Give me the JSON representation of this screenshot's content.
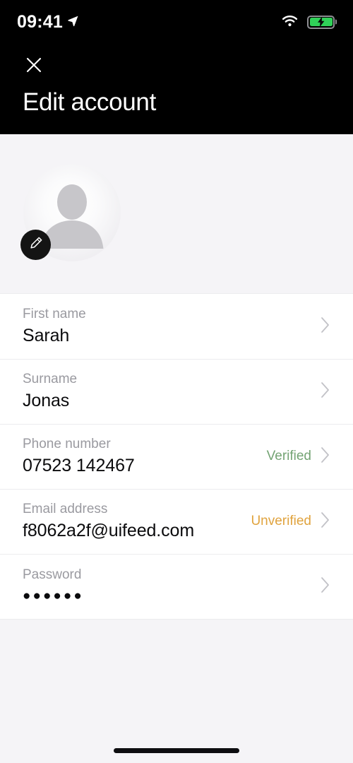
{
  "status_bar": {
    "time": "09:41",
    "location_icon": "location-arrow-icon",
    "wifi_icon": "wifi-icon",
    "battery_icon": "battery-charging-icon",
    "battery_color": "#30d158"
  },
  "header": {
    "close_icon": "close-icon",
    "title": "Edit account",
    "background": "#000000"
  },
  "avatar": {
    "placeholder_icon": "person-silhouette-icon",
    "edit_icon": "pencil-icon",
    "edit_button_label": "Edit profile photo"
  },
  "form": {
    "rows": [
      {
        "name": "first-name",
        "label": "First name",
        "value": "Sarah",
        "status": "",
        "status_kind": "",
        "chevron": "chevron-right-icon"
      },
      {
        "name": "surname",
        "label": "Surname",
        "value": "Jonas",
        "status": "",
        "status_kind": "",
        "chevron": "chevron-right-icon"
      },
      {
        "name": "phone-number",
        "label": "Phone number",
        "value": "07523 142467",
        "status": "Verified",
        "status_kind": "verified",
        "chevron": "chevron-right-icon"
      },
      {
        "name": "email-address",
        "label": "Email address",
        "value": "f8062a2f@uifeed.com",
        "status": "Unverified",
        "status_kind": "unverified",
        "chevron": "chevron-right-icon"
      },
      {
        "name": "password",
        "label": "Password",
        "value": "●●●●●●",
        "status": "",
        "status_kind": "",
        "chevron": "chevron-right-icon"
      }
    ]
  },
  "colors": {
    "page_background": "#f5f4f7",
    "card_background": "#ffffff",
    "divider": "#ececee",
    "label_text": "#9a9aa0",
    "value_text": "#0b0b0d",
    "verified": "#74a474",
    "unverified": "#e0a33e",
    "chevron": "#c2c2c7"
  },
  "home_indicator": "home-indicator"
}
